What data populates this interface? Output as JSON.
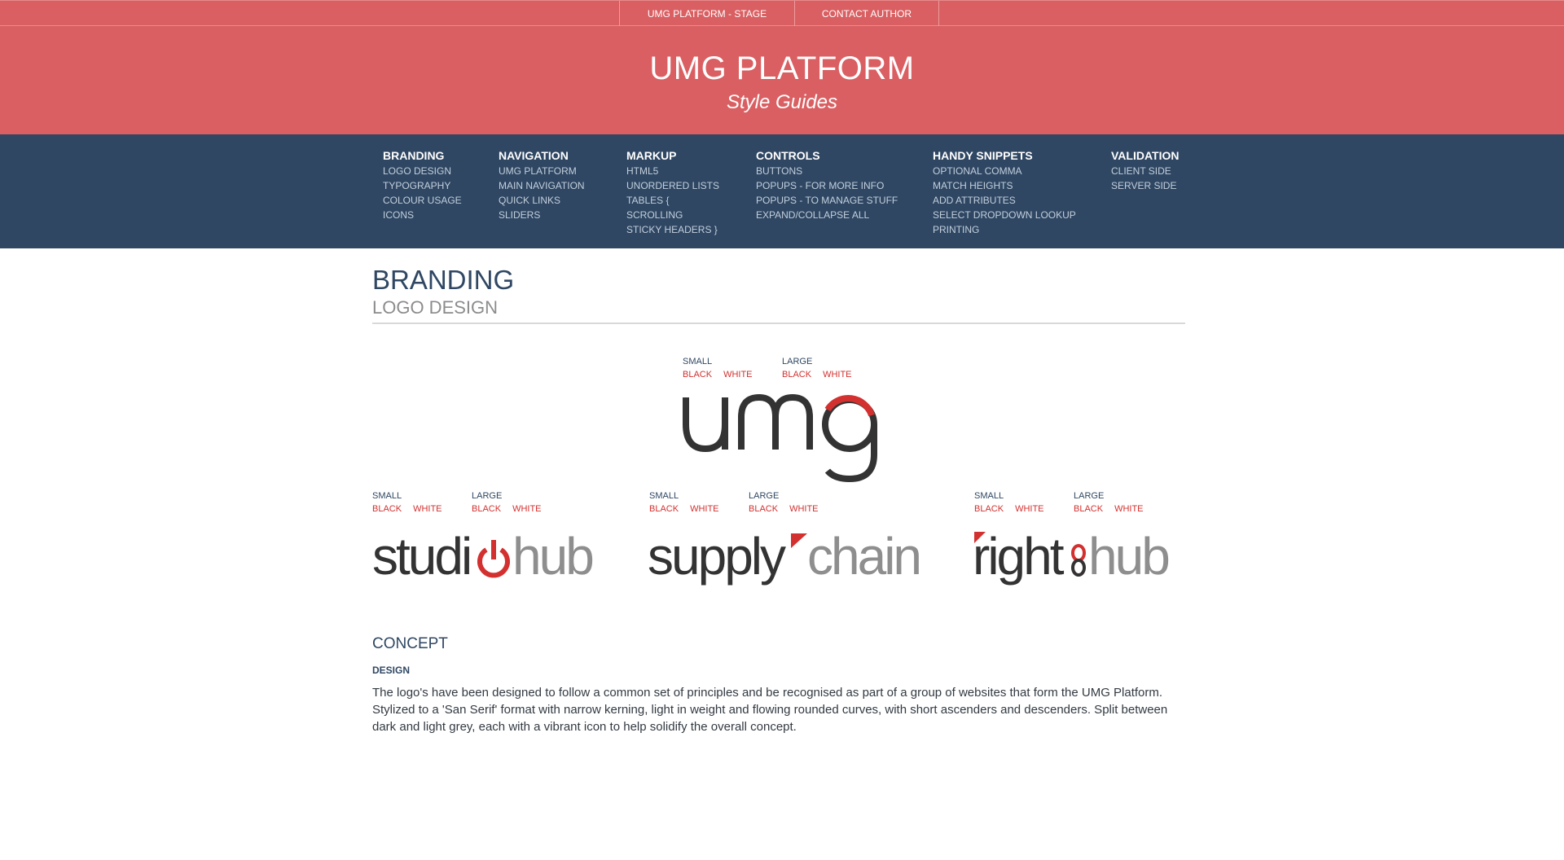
{
  "topbar": {
    "links": [
      "UMG PLATFORM - STAGE",
      "CONTACT AUTHOR"
    ]
  },
  "header": {
    "title": "UMG PLATFORM",
    "subtitle": "Style Guides"
  },
  "nav": {
    "columns": [
      {
        "heading": "BRANDING",
        "items": [
          "LOGO DESIGN",
          "TYPOGRAPHY",
          "COLOUR USAGE",
          "ICONS"
        ]
      },
      {
        "heading": "NAVIGATION",
        "items": [
          "UMG PLATFORM",
          "MAIN NAVIGATION",
          "QUICK LINKS",
          "SLIDERS"
        ]
      },
      {
        "heading": "MARKUP",
        "items": [
          "HTML5",
          "UNORDERED LISTS",
          "TABLES {",
          "SCROLLING",
          "STICKY HEADERS }"
        ]
      },
      {
        "heading": "CONTROLS",
        "items": [
          "BUTTONS",
          "POPUPS - FOR MORE INFO",
          "POPUPS - TO MANAGE STUFF",
          "EXPAND/COLLAPSE ALL"
        ]
      },
      {
        "heading": "HANDY SNIPPETS",
        "items": [
          "OPTIONAL COMMA",
          "MATCH HEIGHTS",
          "ADD ATTRIBUTES",
          "SELECT DROPDOWN LOOKUP",
          "PRINTING"
        ]
      },
      {
        "heading": "VALIDATION",
        "items": [
          "CLIENT SIDE",
          "SERVER SIDE"
        ]
      }
    ]
  },
  "main": {
    "title": "BRANDING",
    "subtitle": "LOGO DESIGN",
    "variant_labels": {
      "small": "SMALL",
      "large": "LARGE",
      "black": "BLACK",
      "white": "WHITE"
    },
    "logos": {
      "umg": {
        "dark": "um",
        "accent_icon": "g-icon"
      },
      "studiohub": {
        "dark": "studi",
        "light": "hub",
        "accent_icon": "power-icon"
      },
      "supplychain": {
        "dark": "supply",
        "light": "chain",
        "accent_icon": "triangle-icon"
      },
      "rightshub": {
        "dark": "right",
        "light": "hub",
        "accent_icon": "chain-link-icon"
      }
    },
    "concept": {
      "title": "CONCEPT",
      "label": "DESIGN",
      "text": "The logo's have been designed to follow a common set of principles and be recognised as part of a group of websites that form the UMG Platform. Stylized to a 'San Serif' format with narrow kerning, light in weight and flowing rounded curves, with short ascenders and descenders. Split between dark and light grey, each with a vibrant icon to help solidify the overall concept."
    }
  },
  "colors": {
    "header_red": "#d95f62",
    "nav_navy": "#2f4763",
    "accent_red": "#d2312f",
    "logo_dark": "#333333",
    "logo_light": "#8e8e8e"
  }
}
